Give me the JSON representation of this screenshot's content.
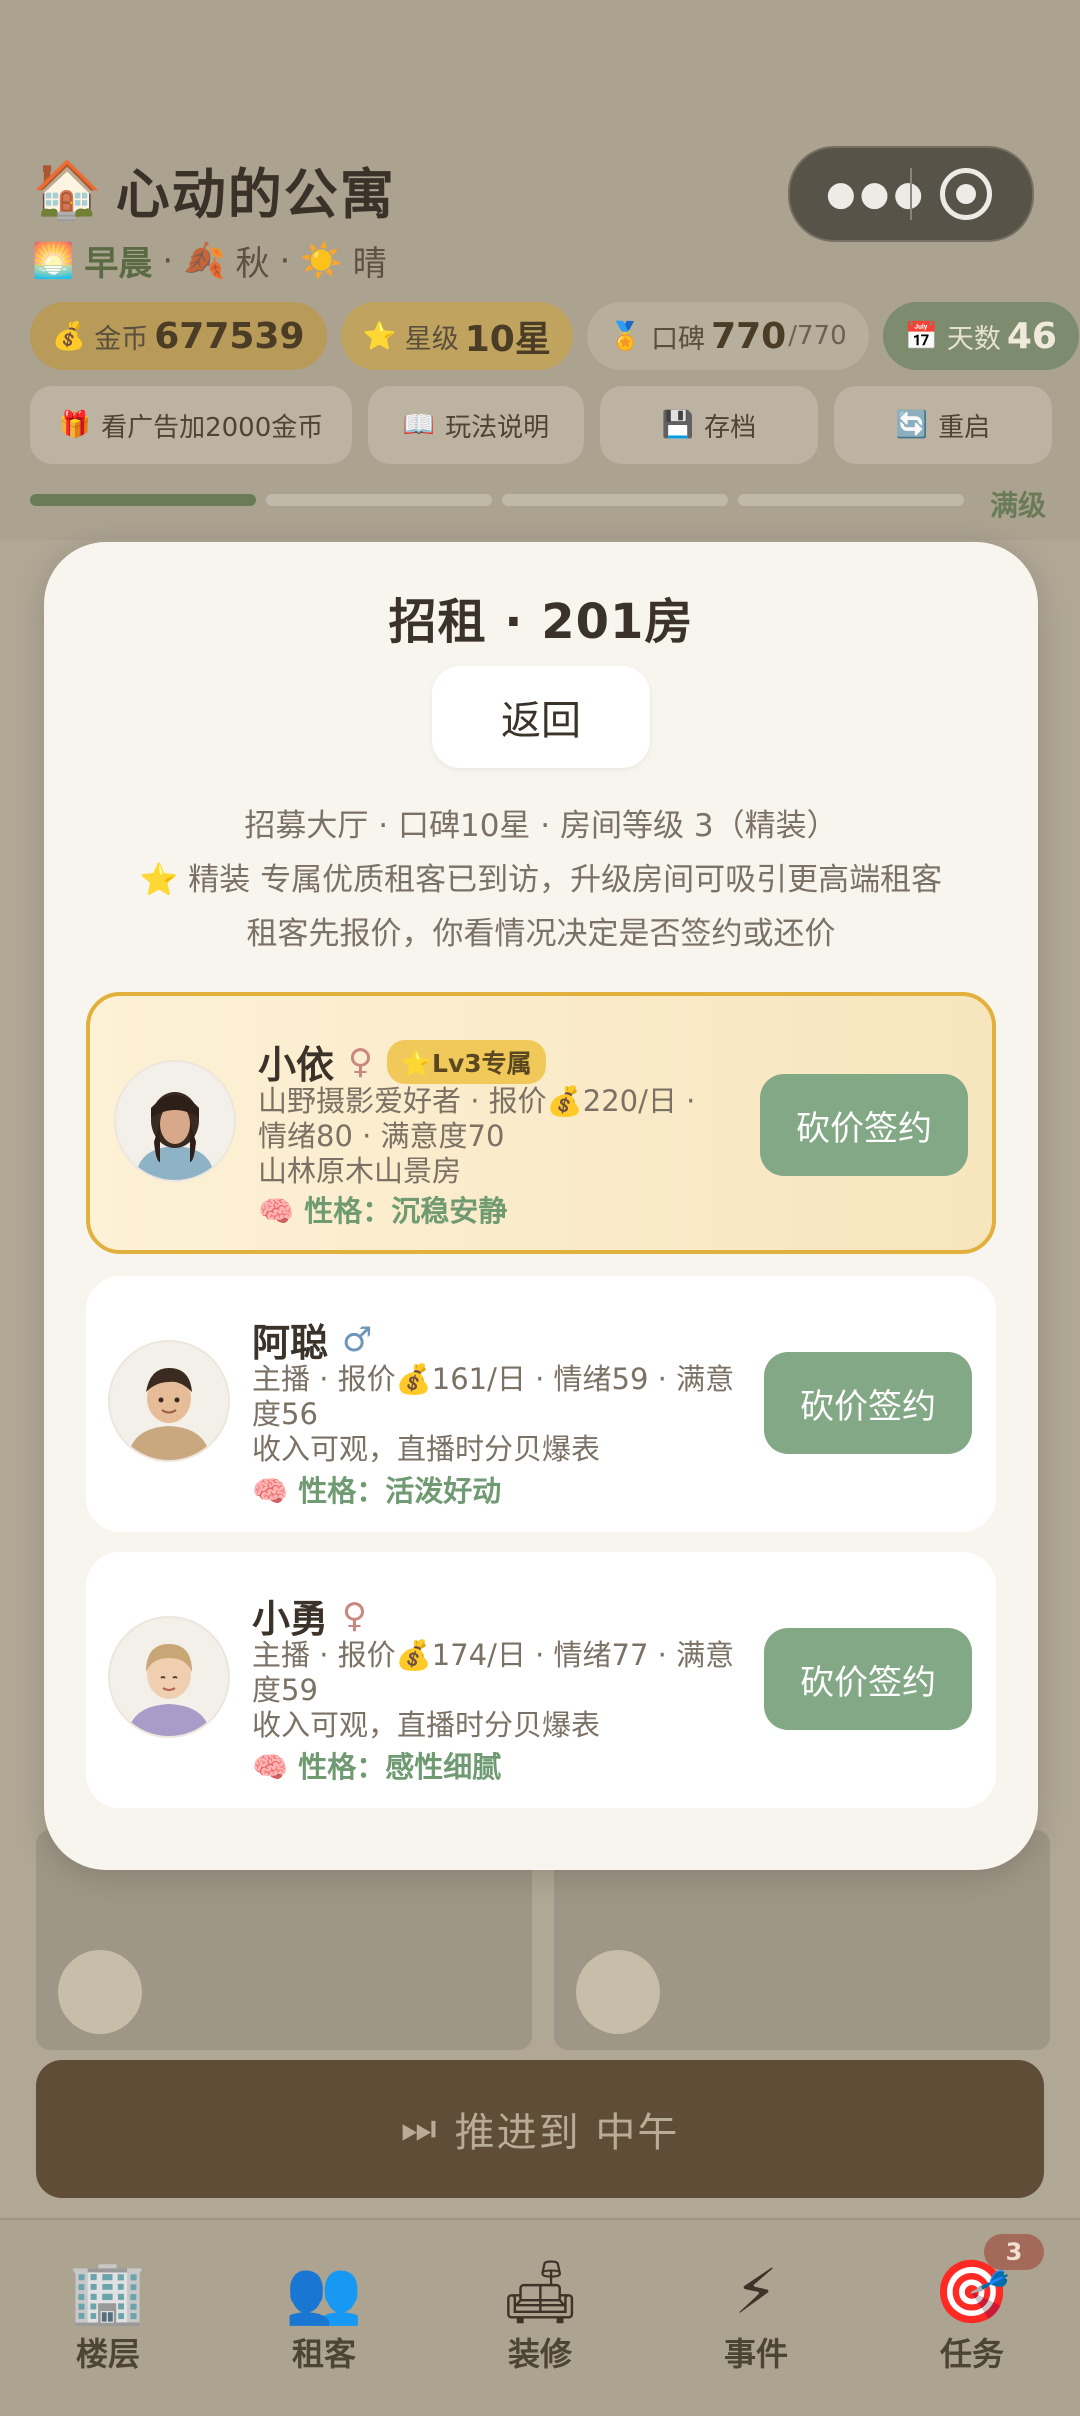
{
  "app": {
    "title": "心动的公寓",
    "title_icon": "house-icon",
    "time": "早晨",
    "season": "秋",
    "weather": "晴",
    "separator": "·"
  },
  "stats": {
    "gold_label": "金币",
    "gold_value": "677539",
    "star_label": "星级",
    "star_value": "10星",
    "rep_label": "口碑",
    "rep_value": "770",
    "rep_max": "/770",
    "days_label": "天数",
    "days_value": "46"
  },
  "actions": {
    "ad": "看广告加2000金币",
    "guide": "玩法说明",
    "save": "存档",
    "restart": "重启"
  },
  "progress": {
    "label": "满级",
    "filled_fraction": 0.25
  },
  "modal": {
    "title": "招租 · 201房",
    "back": "返回",
    "info1": "招募大厅 · 口碑10星 · 房间等级 3（精装）",
    "info2": "⭐ 精装 专属优质租客已到访，升级房间可吸引更高端租客",
    "info3": "租客先报价，你看情况决定是否签约或还价"
  },
  "tenants": [
    {
      "name": "小依",
      "gender": "♀",
      "badge": "⭐Lv3专属",
      "line1": "山野摄影爱好者 · 报价💰220/日 ·",
      "line2": "情绪80 · 满意度70",
      "line3": "山林原木山景房",
      "trait": "🧠 性格：沉稳安静",
      "action": "砍价签约"
    },
    {
      "name": "阿聪",
      "gender": "♂",
      "line1": "主播 · 报价💰161/日 · 情绪59 · 满意",
      "line2": "度56",
      "line3": "收入可观，直播时分贝爆表",
      "trait": "🧠 性格：活泼好动",
      "action": "砍价签约"
    },
    {
      "name": "小勇",
      "gender": "♀",
      "line1": "主播 · 报价💰174/日 · 情绪77 · 满意",
      "line2": "度59",
      "line3": "收入可观，直播时分贝爆表",
      "trait": "🧠 性格：感性细腻",
      "action": "砍价签约"
    }
  ],
  "advance": {
    "label": "推进到 中午",
    "icon": "fast-forward-icon"
  },
  "tabs": [
    {
      "label": "楼层",
      "icon": "building-icon"
    },
    {
      "label": "租客",
      "icon": "people-icon"
    },
    {
      "label": "装修",
      "icon": "sofa-icon"
    },
    {
      "label": "事件",
      "icon": "lightning-icon"
    },
    {
      "label": "任务",
      "icon": "target-icon",
      "badge": "3"
    }
  ],
  "colors": {
    "accent_green": "#83a886",
    "badge_gold": "#f0c95a",
    "featured_border": "#e2b03c"
  }
}
